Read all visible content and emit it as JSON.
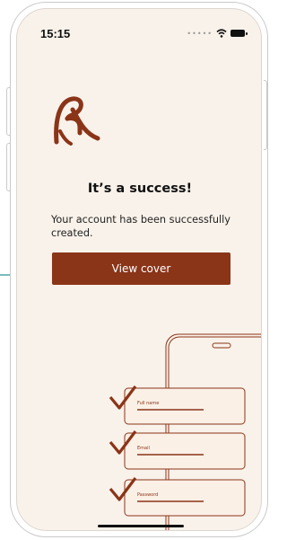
{
  "status_bar": {
    "time": "15:15"
  },
  "content": {
    "title": "It’s a success!",
    "message": "Your account has been successfully created.",
    "button_label": "View cover"
  },
  "illustration": {
    "fields": [
      "Full name",
      "Email",
      "Password"
    ]
  },
  "icons": {
    "logo": "brand-logo",
    "signal": "signal-dots-icon",
    "wifi": "wifi-icon",
    "battery": "battery-icon",
    "check": "checkmark-icon",
    "arrow": "arrow-right-icon"
  },
  "colors": {
    "background": "#f9f2ea",
    "accent": "#8a3418",
    "callout": "#4fa3a8"
  }
}
